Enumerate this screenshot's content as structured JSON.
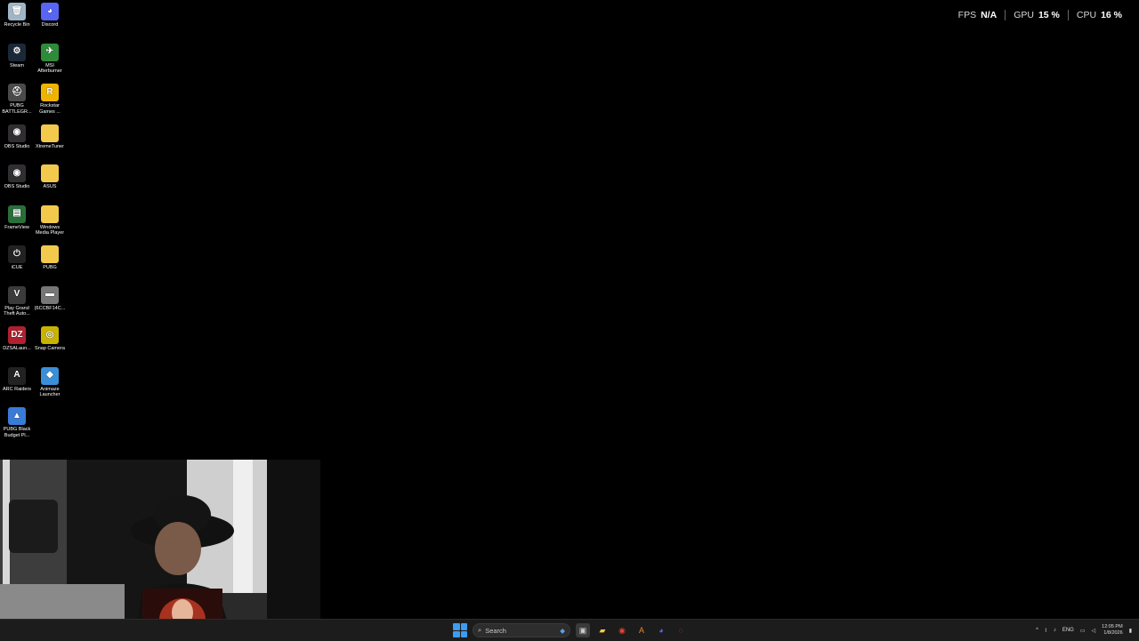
{
  "desktop": {
    "icons": [
      {
        "label": "Recycle Bin",
        "icon": "recycle-bin-icon",
        "color": "#9fb6c9",
        "glyph": "🗑"
      },
      {
        "label": "Discord",
        "icon": "discord-icon",
        "color": "#5865f2",
        "glyph": "◕"
      },
      {
        "label": "Steam",
        "icon": "steam-icon",
        "color": "#1b2838",
        "glyph": "⚙"
      },
      {
        "label": "MSI Afterburner",
        "icon": "msi-afterburner-icon",
        "color": "#2e8b3a",
        "glyph": "✈"
      },
      {
        "label": "PUBG BATTLEGR...",
        "icon": "pubg-helmet-icon",
        "color": "#4a4a4a",
        "glyph": "⛑"
      },
      {
        "label": "Rockstar Games ...",
        "icon": "rockstar-icon",
        "color": "#f0b400",
        "glyph": "R"
      },
      {
        "label": "OBS Studio",
        "icon": "obs-icon",
        "color": "#302e31",
        "glyph": "◉"
      },
      {
        "label": "XtremeTuner",
        "icon": "folder-icon",
        "color": "#f2c94c",
        "glyph": ""
      },
      {
        "label": "OBS Studio",
        "icon": "obs-icon",
        "color": "#302e31",
        "glyph": "◉"
      },
      {
        "label": "ASUS",
        "icon": "folder-icon",
        "color": "#f2c94c",
        "glyph": ""
      },
      {
        "label": "FrameView",
        "icon": "frameview-icon",
        "color": "#2a6f3a",
        "glyph": "▤"
      },
      {
        "label": "Windows Media Player",
        "icon": "folder-icon",
        "color": "#f2c94c",
        "glyph": ""
      },
      {
        "label": "iCUE",
        "icon": "icue-icon",
        "color": "#222222",
        "glyph": "⏻"
      },
      {
        "label": "PUBG",
        "icon": "folder-icon",
        "color": "#f2c94c",
        "glyph": ""
      },
      {
        "label": "Play Grand Theft Auto...",
        "icon": "gta-icon",
        "color": "#3b3b3b",
        "glyph": "V"
      },
      {
        "label": "{6CCBF14C...",
        "icon": "file-icon",
        "color": "#777777",
        "glyph": "▬"
      },
      {
        "label": "DZSALaun...",
        "icon": "dzsa-icon",
        "color": "#b02030",
        "glyph": "DZ"
      },
      {
        "label": "Snap Camera",
        "icon": "snap-camera-icon",
        "color": "#c8b400",
        "glyph": "◎"
      },
      {
        "label": "ARC Raiders",
        "icon": "arc-raiders-icon",
        "color": "#222222",
        "glyph": "A"
      },
      {
        "label": "Animaze Launcher",
        "icon": "animaze-icon",
        "color": "#3a8fd8",
        "glyph": "◆"
      },
      {
        "label": "PUBG Black Budget Pl...",
        "icon": "pubg-black-budget-icon",
        "color": "#3a7bd5",
        "glyph": "▲"
      }
    ]
  },
  "overlay": {
    "fps_label": "FPS",
    "fps_value": "N/A",
    "gpu_label": "GPU",
    "gpu_value": "15 %",
    "cpu_label": "CPU",
    "cpu_value": "16 %"
  },
  "taskbar": {
    "search_placeholder": "Search",
    "tray_lang": "ENG",
    "time": "12:05 PM",
    "date": "1/8/2026"
  },
  "colors": {
    "accent": "#3d9cf0",
    "taskbar_bg": "#1c1c1c"
  }
}
